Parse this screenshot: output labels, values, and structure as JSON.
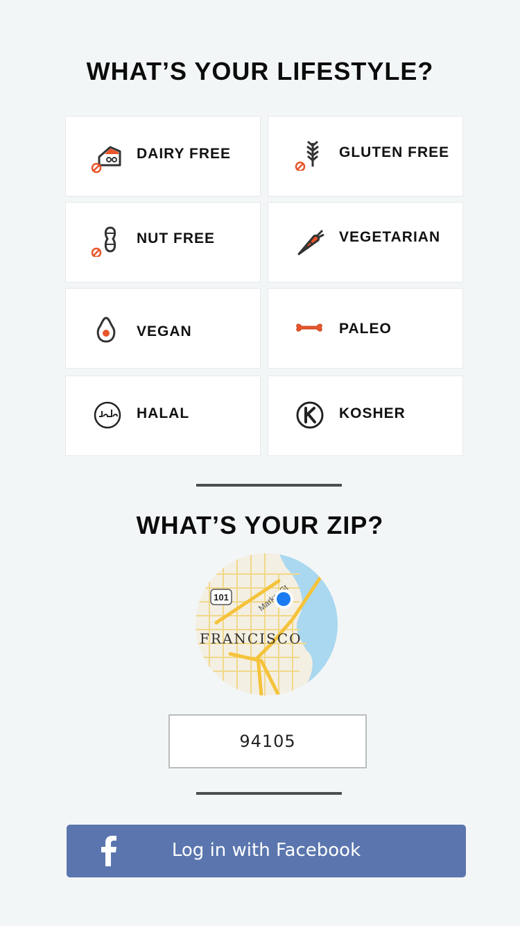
{
  "lifestyle": {
    "title": "WHAT’S YOUR LIFESTYLE?",
    "options": [
      {
        "label": "DAIRY FREE",
        "icon": "dairy-free-icon"
      },
      {
        "label": "GLUTEN FREE",
        "icon": "gluten-free-icon"
      },
      {
        "label": "NUT FREE",
        "icon": "nut-free-icon"
      },
      {
        "label": "VEGETARIAN",
        "icon": "vegetarian-icon"
      },
      {
        "label": "VEGAN",
        "icon": "vegan-icon"
      },
      {
        "label": "PALEO",
        "icon": "paleo-icon"
      },
      {
        "label": "HALAL",
        "icon": "halal-icon"
      },
      {
        "label": "KOSHER",
        "icon": "kosher-icon"
      }
    ]
  },
  "zip": {
    "title": "WHAT’S YOUR ZIP?",
    "value": "94105",
    "map": {
      "city_label": "FRANCISCO",
      "highway_label": "101",
      "street_label": "Market St"
    }
  },
  "facebook": {
    "label": "Log in with Facebook"
  },
  "colors": {
    "accent_orange": "#e8552a",
    "facebook_blue": "#5b76ae",
    "background": "#f3f6f7",
    "location_dot": "#1a7cf0"
  }
}
